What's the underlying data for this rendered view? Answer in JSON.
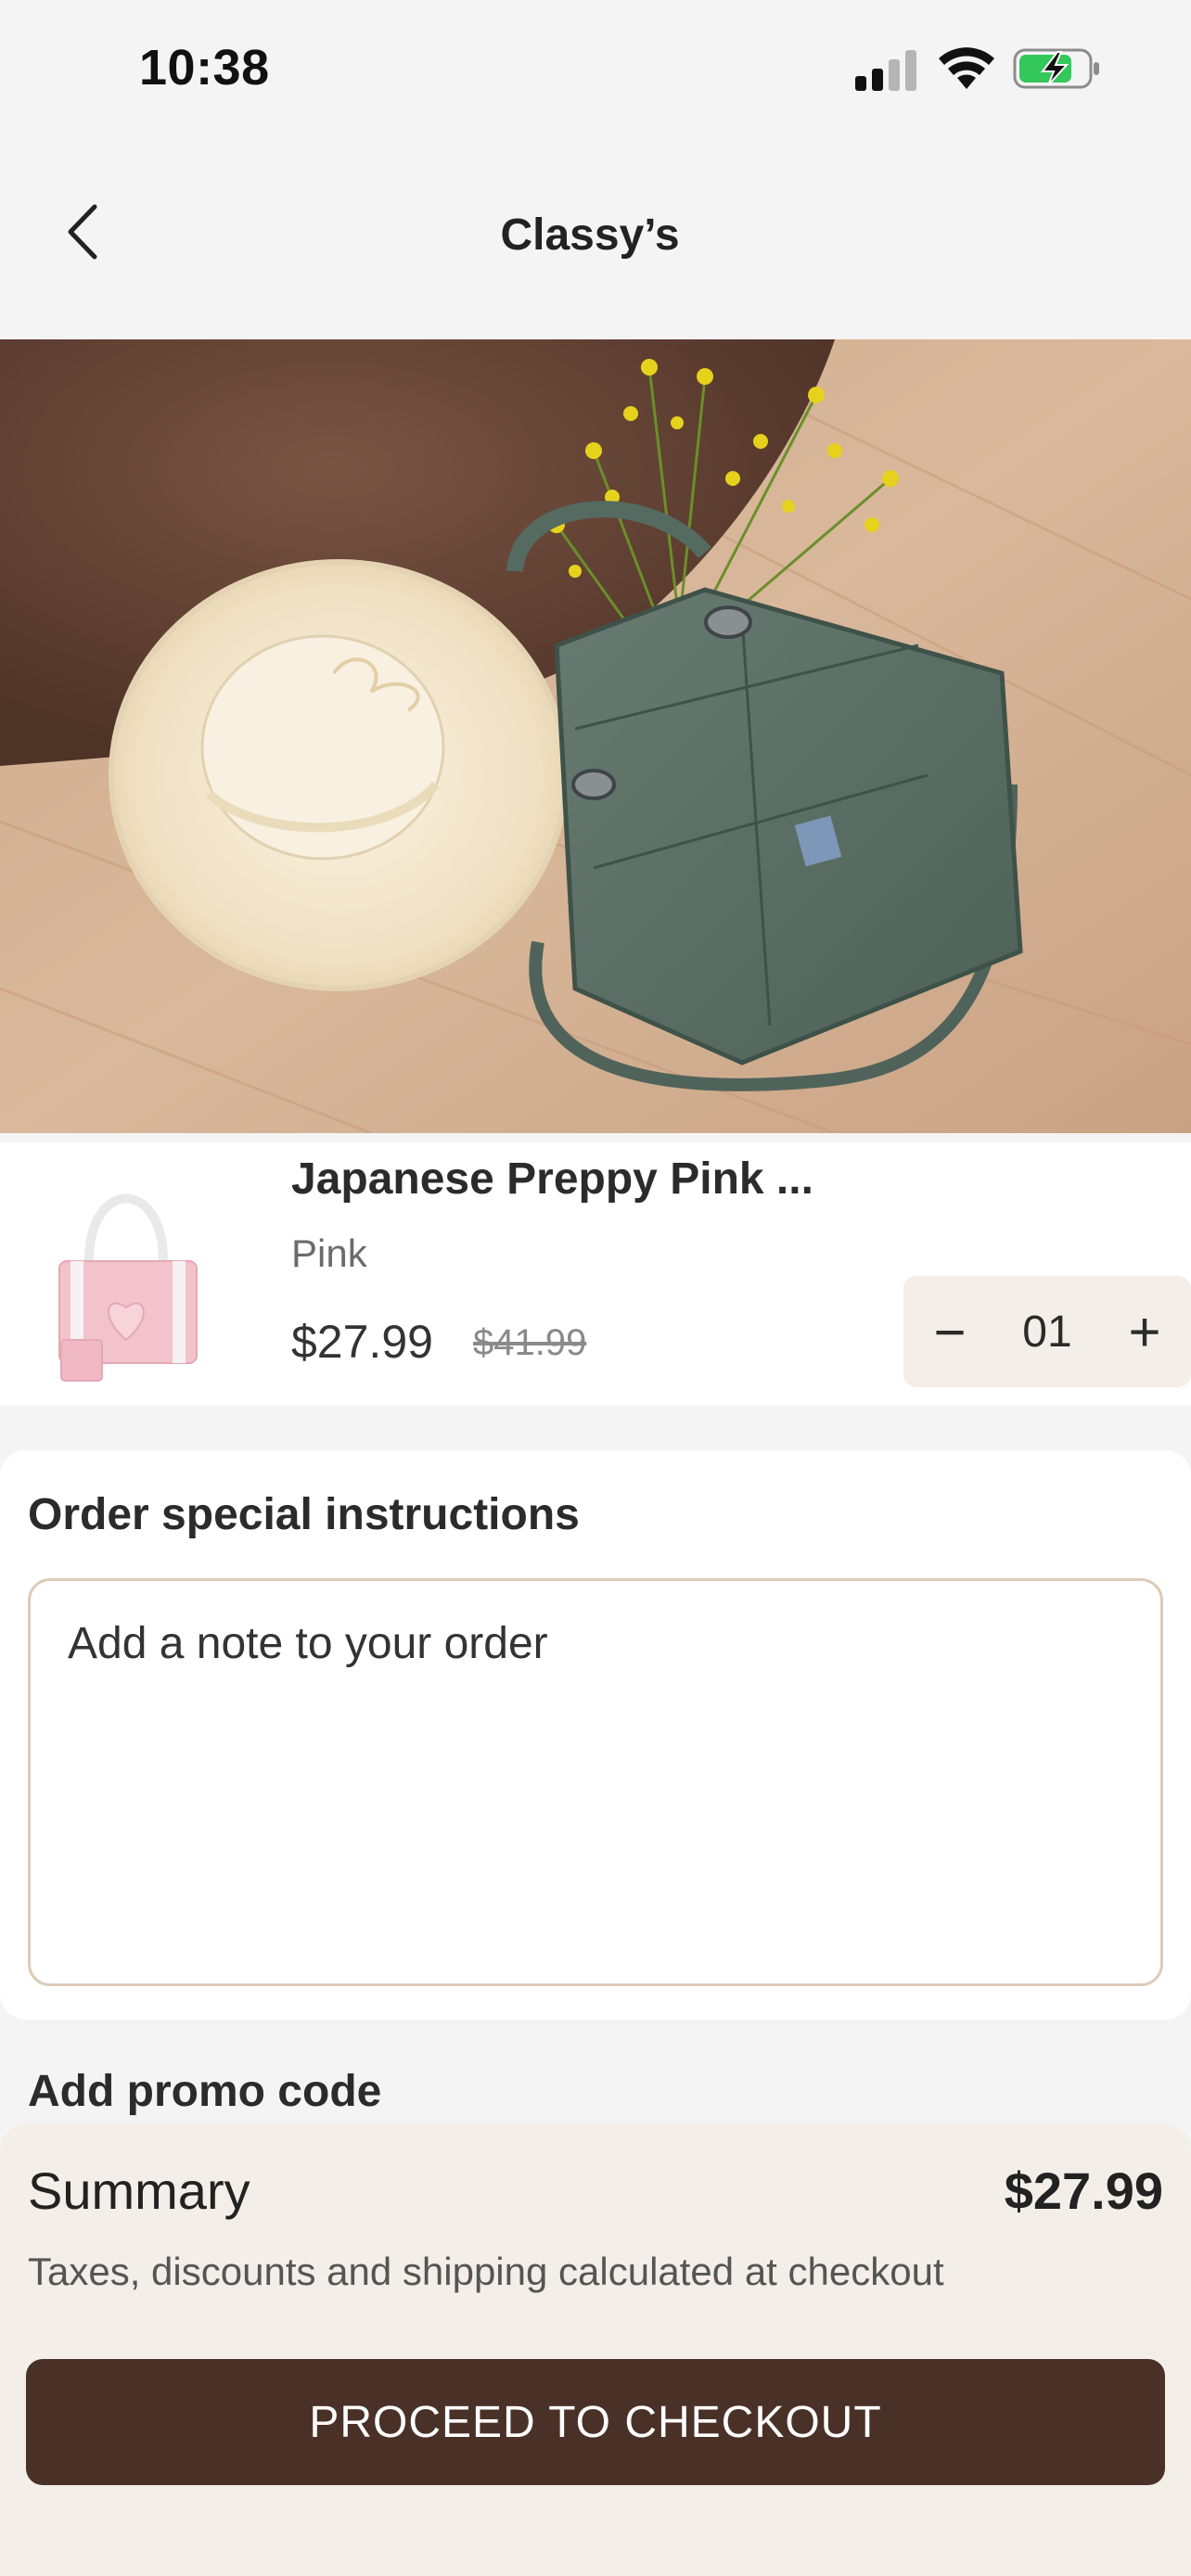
{
  "status_bar": {
    "time": "10:38",
    "icons": [
      "signal-icon",
      "wifi-icon",
      "battery-charging-icon"
    ]
  },
  "nav": {
    "title": "Classy’s",
    "back_icon": "chevron-left-icon"
  },
  "hero": {
    "image": "photo-hat-green-bag-flowers"
  },
  "cart_item": {
    "name": "Japanese Preppy Pink ...",
    "variant": "Pink",
    "price": "$27.99",
    "compare_at_price": "$41.99",
    "quantity": "01",
    "minus_label": "−",
    "plus_label": "+"
  },
  "instructions": {
    "title": "Order special instructions",
    "placeholder": "Add a note to your order"
  },
  "promo": {
    "label": "Add promo code"
  },
  "summary": {
    "label": "Summary",
    "total": "$27.99",
    "note": "Taxes, discounts and shipping calculated at checkout",
    "checkout_label": "PROCEED TO CHECKOUT"
  },
  "colors": {
    "accent": "#4a3128",
    "sheet": "#f3eee8",
    "field_border": "#dccbb8",
    "background": "#f4f4f4"
  }
}
